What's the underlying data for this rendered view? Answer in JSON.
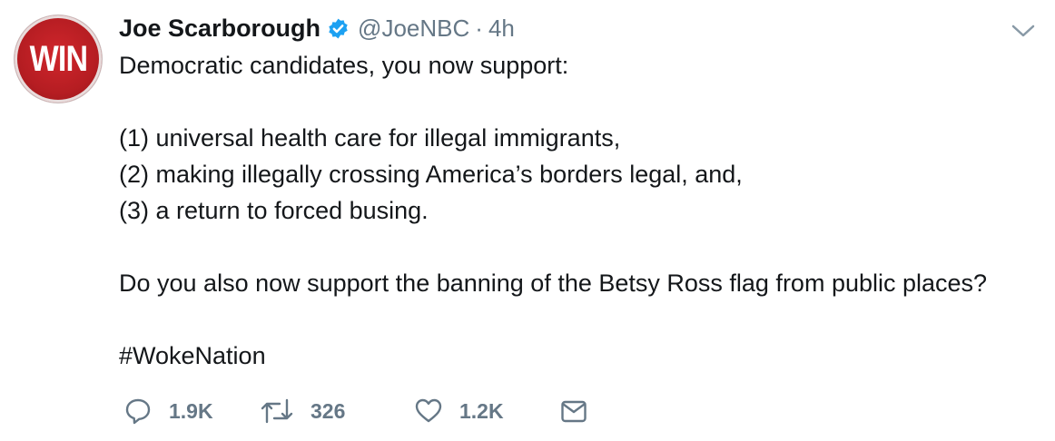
{
  "tweet": {
    "avatar_text": "WIN",
    "display_name": "Joe Scarborough",
    "verified": true,
    "handle": "@JoeNBC",
    "separator": "·",
    "time": "4h",
    "lines": [
      "Democratic candidates, you now support:",
      "(1) universal health care for illegal immigrants,",
      "(2) making illegally crossing America’s borders legal, and,",
      "(3) a return to forced busing.",
      "Do you also now support the banning of the Betsy Ross flag from public places?",
      "#WokeNation"
    ]
  },
  "actions": {
    "reply_count": "1.9K",
    "retweet_count": "326",
    "like_count": "1.2K"
  },
  "colors": {
    "text": "#14171a",
    "secondary": "#657786",
    "verified": "#1da1f2",
    "avatar_red": "#c0232a"
  },
  "icons": [
    "verified-badge-icon",
    "chevron-down-icon",
    "reply-icon",
    "retweet-icon",
    "like-icon",
    "direct-message-icon"
  ]
}
